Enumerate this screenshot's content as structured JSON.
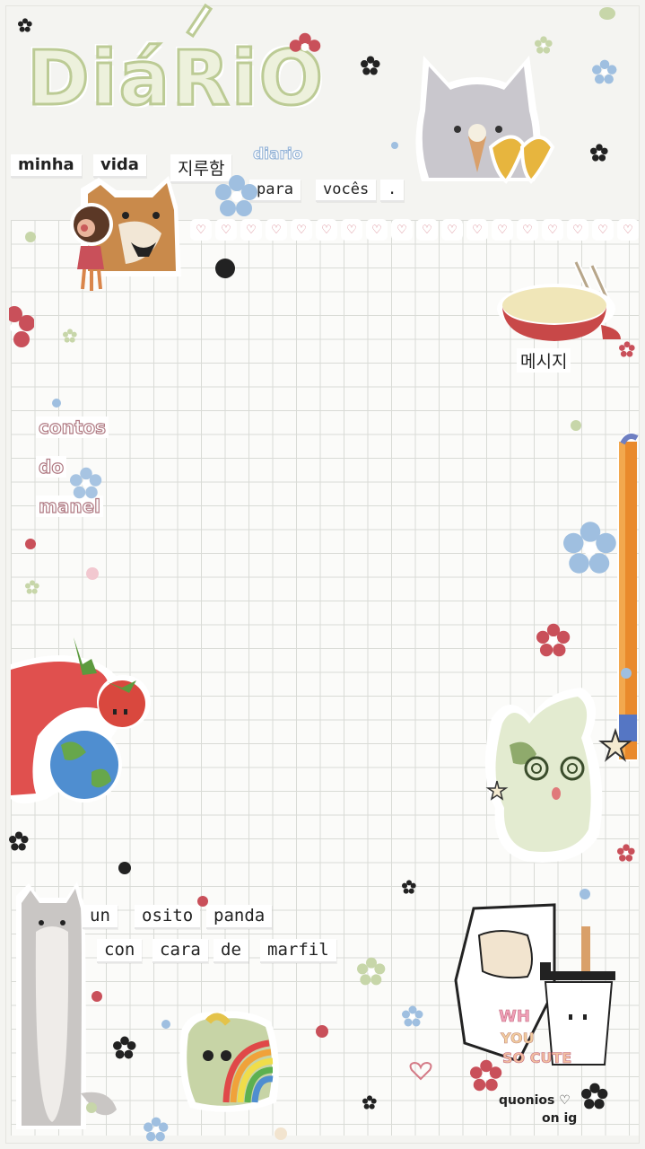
{
  "title": "DiáRiO",
  "header_words": [
    "minha",
    "vida",
    "지루함"
  ],
  "tag_small": "diario",
  "subtitle_words": [
    "para",
    "vocês",
    "."
  ],
  "korean_label": "메시지",
  "side_words": [
    "contos",
    "do",
    "manel"
  ],
  "bottom_line_1": [
    "un",
    "osito",
    "panda"
  ],
  "bottom_line_2": [
    "con",
    "cara",
    "de",
    "marfil"
  ],
  "credit_line_1": "quonios ♡",
  "credit_line_2": "on ig",
  "sticker_text": {
    "cup_text_1": "WH",
    "cup_text_2": "YOU",
    "cup_text_3": "SO CUTE"
  },
  "colors": {
    "title_fill": "#edf1dc",
    "title_stroke": "#bccb95",
    "heart": "#d47a86",
    "flower_red": "#c9505a",
    "flower_blue": "#8fb0d6",
    "grid": "#d9dbd6"
  },
  "icons": [
    "flower-icon",
    "heart-icon",
    "star-icon",
    "cat-sticker",
    "pusheen-sticker",
    "fondue-sticker",
    "strawberry-sticker",
    "earth-sticker",
    "tomato-sticker",
    "bunny-sticker",
    "long-cat-sticker",
    "toast-sticker",
    "coffee-cup-sticker",
    "pencil-sticker"
  ]
}
